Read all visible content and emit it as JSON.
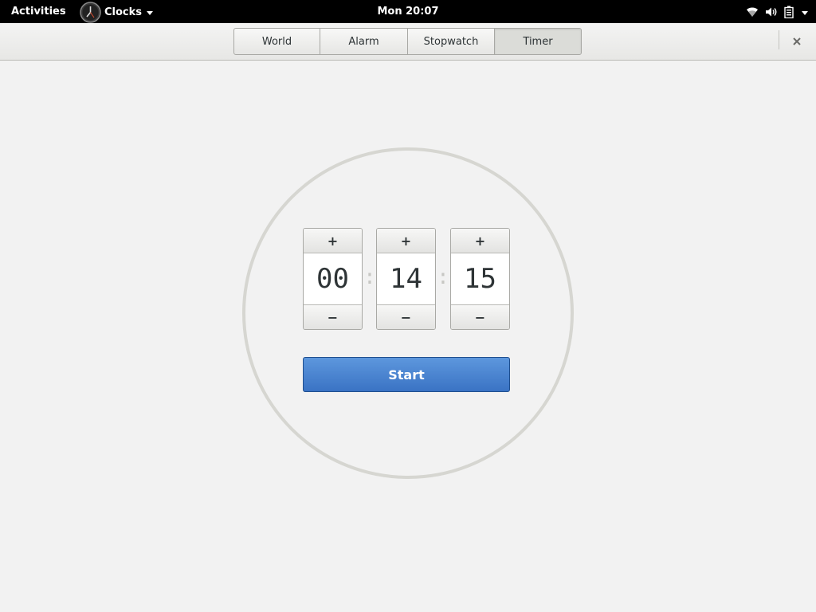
{
  "topbar": {
    "activities": "Activities",
    "app_name": "Clocks",
    "clock": "Mon 20:07",
    "icons": [
      "clocks-app-icon",
      "wifi-icon",
      "volume-icon",
      "battery-icon",
      "caret-down-icon"
    ]
  },
  "header": {
    "tabs": [
      {
        "label": "World",
        "active": false
      },
      {
        "label": "Alarm",
        "active": false
      },
      {
        "label": "Stopwatch",
        "active": false
      },
      {
        "label": "Timer",
        "active": true
      }
    ],
    "close_icon": "close-icon"
  },
  "timer": {
    "hours": "00",
    "minutes": "14",
    "seconds": "15",
    "separator": ":",
    "increment_label": "+",
    "decrement_label": "−",
    "start_label": "Start"
  },
  "colors": {
    "accent": "#4a86d5",
    "ring": "#d6d6d1",
    "background": "#f2f2f2"
  }
}
